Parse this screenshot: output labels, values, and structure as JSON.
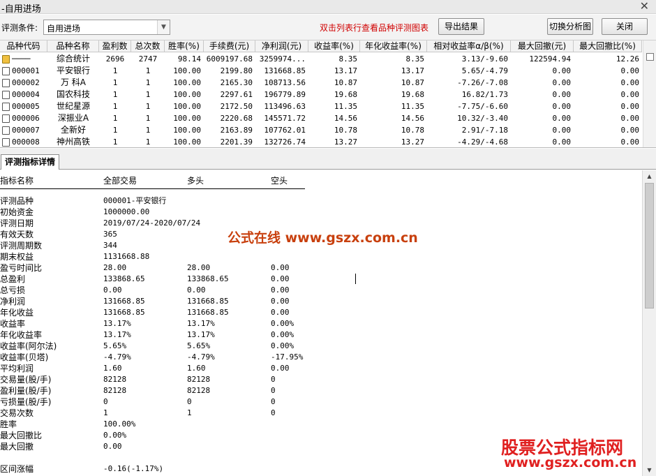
{
  "window": {
    "title": "-自用进场",
    "close_glyph": "✕"
  },
  "toolbar": {
    "condition_label": "评测条件:",
    "condition_value": "自用进场",
    "hint": "双击列表行查看品种评测图表",
    "export_label": "导出结果",
    "switch_label": "切换分析图",
    "close_label": "关闭"
  },
  "grid": {
    "headers": [
      "品种代码",
      "品种名称",
      "盈利数",
      "总次数",
      "胜率(%)",
      "手续费(元)",
      "净利润(元)",
      "收益率(%)",
      "年化收益率(%)",
      "相对收益率α/β(%)",
      "最大回撤(元)",
      "最大回撤比(%)"
    ],
    "rows": [
      {
        "code": "────",
        "name": "综合统计",
        "profit": "2696",
        "total": "2747",
        "winrate": "98.14",
        "fee": "6009197.68",
        "net": "3259974...",
        "ret": "8.35",
        "annual": "8.35",
        "rel": "3.13/-9.60",
        "maxdd": "122594.94",
        "maxddr": "12.26",
        "icon": "folder-star-icon"
      },
      {
        "code": "000001",
        "name": "平安银行",
        "profit": "1",
        "total": "1",
        "winrate": "100.00",
        "fee": "2199.80",
        "net": "131668.85",
        "ret": "13.17",
        "annual": "13.17",
        "rel": "5.65/-4.79",
        "maxdd": "0.00",
        "maxddr": "0.00",
        "icon": "document-icon"
      },
      {
        "code": "000002",
        "name": "万 科A",
        "profit": "1",
        "total": "1",
        "winrate": "100.00",
        "fee": "2165.30",
        "net": "108713.56",
        "ret": "10.87",
        "annual": "10.87",
        "rel": "-7.26/-7.08",
        "maxdd": "0.00",
        "maxddr": "0.00",
        "icon": "document-icon"
      },
      {
        "code": "000004",
        "name": "国农科技",
        "profit": "1",
        "total": "1",
        "winrate": "100.00",
        "fee": "2297.61",
        "net": "196779.89",
        "ret": "19.68",
        "annual": "19.68",
        "rel": "16.82/1.73",
        "maxdd": "0.00",
        "maxddr": "0.00",
        "icon": "document-icon"
      },
      {
        "code": "000005",
        "name": "世纪星源",
        "profit": "1",
        "total": "1",
        "winrate": "100.00",
        "fee": "2172.50",
        "net": "113496.63",
        "ret": "11.35",
        "annual": "11.35",
        "rel": "-7.75/-6.60",
        "maxdd": "0.00",
        "maxddr": "0.00",
        "icon": "document-icon"
      },
      {
        "code": "000006",
        "name": "深振业A",
        "profit": "1",
        "total": "1",
        "winrate": "100.00",
        "fee": "2220.68",
        "net": "145571.72",
        "ret": "14.56",
        "annual": "14.56",
        "rel": "10.32/-3.40",
        "maxdd": "0.00",
        "maxddr": "0.00",
        "icon": "document-icon"
      },
      {
        "code": "000007",
        "name": "全新好",
        "profit": "1",
        "total": "1",
        "winrate": "100.00",
        "fee": "2163.89",
        "net": "107762.01",
        "ret": "10.78",
        "annual": "10.78",
        "rel": "2.91/-7.18",
        "maxdd": "0.00",
        "maxddr": "0.00",
        "icon": "document-icon"
      },
      {
        "code": "000008",
        "name": "神州高铁",
        "profit": "1",
        "total": "1",
        "winrate": "100.00",
        "fee": "2201.39",
        "net": "132726.74",
        "ret": "13.27",
        "annual": "13.27",
        "rel": "-4.29/-4.68",
        "maxdd": "0.00",
        "maxddr": "0.00",
        "icon": "document-icon"
      }
    ]
  },
  "details": {
    "tab_label": "评测指标详情",
    "headers": {
      "name": "指标名称",
      "all": "全部交易",
      "long": "多头",
      "short": "空头"
    },
    "rows": [
      {
        "label": "评测品种",
        "all": "000001-平安银行",
        "long": "",
        "short": ""
      },
      {
        "label": "初始资金",
        "all": "1000000.00",
        "long": "",
        "short": ""
      },
      {
        "label": "评测日期",
        "all": "2019/07/24-2020/07/24",
        "long": "",
        "short": ""
      },
      {
        "label": "有效天数",
        "all": "365",
        "long": "",
        "short": ""
      },
      {
        "label": "评测周期数",
        "all": "344",
        "long": "",
        "short": ""
      },
      {
        "label": "期末权益",
        "all": "1131668.88",
        "long": "",
        "short": ""
      },
      {
        "label": "盈亏时间比",
        "all": "28.00",
        "long": "28.00",
        "short": "0.00"
      },
      {
        "label": "总盈利",
        "all": "133868.65",
        "long": "133868.65",
        "short": "0.00"
      },
      {
        "label": "总亏损",
        "all": "0.00",
        "long": "0.00",
        "short": "0.00"
      },
      {
        "label": "净利润",
        "all": "131668.85",
        "long": "131668.85",
        "short": "0.00"
      },
      {
        "label": "年化收益",
        "all": "131668.85",
        "long": "131668.85",
        "short": "0.00"
      },
      {
        "label": "收益率",
        "all": "13.17%",
        "long": "13.17%",
        "short": "0.00%"
      },
      {
        "label": "年化收益率",
        "all": "13.17%",
        "long": "13.17%",
        "short": "0.00%"
      },
      {
        "label": "收益率(阿尔法)",
        "all": "5.65%",
        "long": "5.65%",
        "short": "0.00%"
      },
      {
        "label": "收益率(贝塔)",
        "all": "-4.79%",
        "long": "-4.79%",
        "short": "-17.95%"
      },
      {
        "label": "平均利润",
        "all": "1.60",
        "long": "1.60",
        "short": "0.00"
      },
      {
        "label": "交易量(股/手)",
        "all": "82128",
        "long": "82128",
        "short": "0"
      },
      {
        "label": "盈利量(股/手)",
        "all": "82128",
        "long": "82128",
        "short": "0"
      },
      {
        "label": "亏损量(股/手)",
        "all": "0",
        "long": "0",
        "short": "0"
      },
      {
        "label": "交易次数",
        "all": "1",
        "long": "1",
        "short": "0"
      },
      {
        "label": "胜率",
        "all": "100.00%",
        "long": "",
        "short": ""
      },
      {
        "label": "最大回撤比",
        "all": "0.00%",
        "long": "",
        "short": ""
      },
      {
        "label": "最大回撤",
        "all": "0.00",
        "long": "",
        "short": ""
      },
      {
        "label": "",
        "all": "",
        "long": "",
        "short": ""
      },
      {
        "label": "区间涨幅",
        "all": "-0.16(-1.17%)",
        "long": "",
        "short": ""
      }
    ]
  },
  "watermarks": {
    "center": "公式在线  www.gszx.com.cn",
    "corner_title": "股票公式指标网",
    "corner_url": "www.gszx.com.cn"
  },
  "colors": {
    "hint_red": "#d00000",
    "watermark_orange": "#c8400e",
    "watermark_red": "#e02020"
  }
}
